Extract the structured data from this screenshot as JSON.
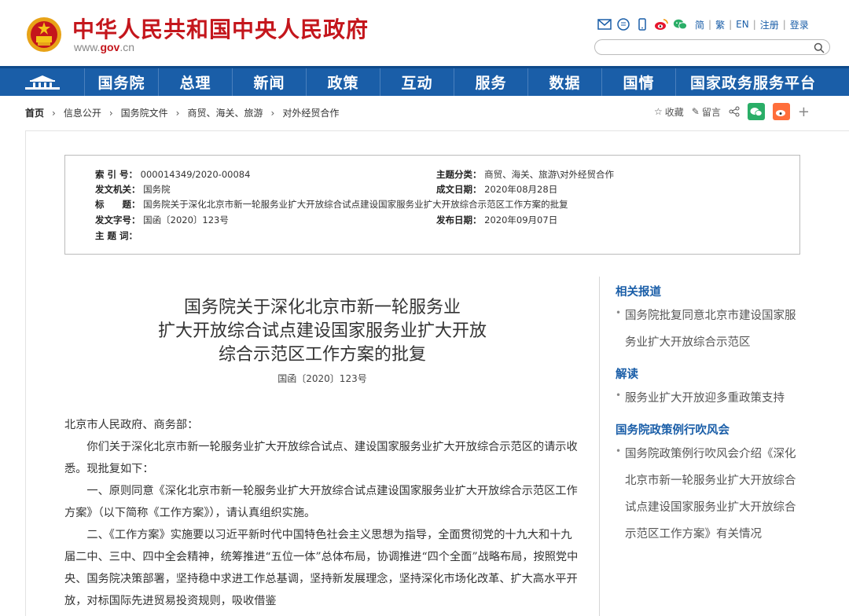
{
  "site": {
    "title": "中华人民共和国中央人民政府",
    "url_prefix": "www.",
    "url_brand": "gov",
    "url_suffix": ".cn",
    "brand_color": "#c4161c",
    "nav_color": "#1a5ea8"
  },
  "top_links": [
    "简",
    "繁",
    "EN",
    "注册",
    "登录"
  ],
  "top_icons": [
    "mail-icon",
    "chat-icon",
    "mobile-icon",
    "weibo-icon",
    "wechat-icon"
  ],
  "search": {
    "placeholder": ""
  },
  "nav": {
    "items": [
      "国务院",
      "总理",
      "新闻",
      "政策",
      "互动",
      "服务",
      "数据",
      "国情",
      "国家政务服务平台"
    ]
  },
  "breadcrumb": {
    "home": "首页",
    "items": [
      "信息公开",
      "国务院文件",
      "商贸、海关、旅游",
      "对外经贸合作"
    ]
  },
  "tools": {
    "favorite": "收藏",
    "comment": "留言",
    "plus": "+"
  },
  "meta": {
    "index_label": "索 引 号：",
    "index_value": "000014349/2020-00084",
    "topic_label": "主题分类：",
    "topic_value": "商贸、海关、旅游\\对外经贸合作",
    "issuer_label": "发文机关：",
    "issuer_value": "国务院",
    "date_label": "成文日期：",
    "date_value": "2020年08月28日",
    "title_label": "标　　题：",
    "title_value": "国务院关于深化北京市新一轮服务业扩大开放综合试点建设国家服务业扩大开放综合示范区工作方案的批复",
    "docno_label": "发文字号：",
    "docno_value": "国函〔2020〕123号",
    "pub_label": "发布日期：",
    "pub_value": "2020年09月07日",
    "keywords_label": "主 题 词："
  },
  "article": {
    "title_line1": "国务院关于深化北京市新一轮服务业",
    "title_line2": "扩大开放综合试点建设国家服务业扩大开放",
    "title_line3": "综合示范区工作方案的批复",
    "doc_no": "国函〔2020〕123号",
    "salutation": "北京市人民政府、商务部：",
    "p1": "你们关于深化北京市新一轮服务业扩大开放综合试点、建设国家服务业扩大开放综合示范区的请示收悉。现批复如下：",
    "p2": "一、原则同意《深化北京市新一轮服务业扩大开放综合试点建设国家服务业扩大开放综合示范区工作方案》（以下简称《工作方案》），请认真组织实施。",
    "p3": "二、《工作方案》实施要以习近平新时代中国特色社会主义思想为指导，全面贯彻党的十九大和十九届二中、三中、四中全会精神，统筹推进“五位一体”总体布局，协调推进“四个全面”战略布局，按照党中央、国务院决策部署，坚持稳中求进工作总基调，坚持新发展理念，坚持深化市场化改革、扩大高水平开放，对标国际先进贸易投资规则，吸收借鉴"
  },
  "sidebar": {
    "related_title": "相关报道",
    "related_item": "国务院批复同意北京市建设国家服务业扩大开放综合示范区",
    "interp_title": "解读",
    "interp_item": "服务业扩大开放迎多重政策支持",
    "briefing_title": "国务院政策例行吹风会",
    "briefing_item": "国务院政策例行吹风会介绍《深化北京市新一轮服务业扩大开放综合试点建设国家服务业扩大开放综合示范区工作方案》有关情况"
  }
}
